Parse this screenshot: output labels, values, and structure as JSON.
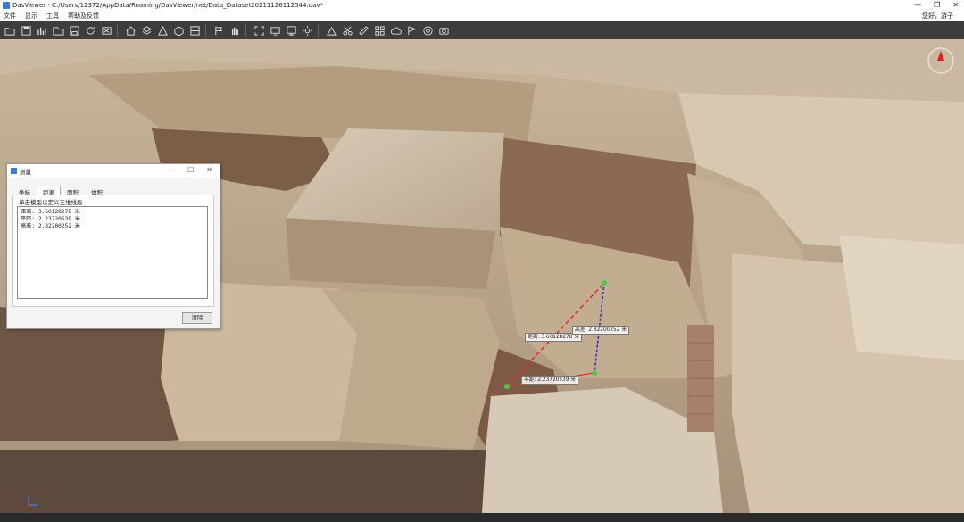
{
  "window": {
    "title": "DasViewer - C:/Users/12372/AppData/Roaming/DasViewer/net/Data_Dataset20211126112544.dav*",
    "controls": [
      "—",
      "❐",
      "✕"
    ]
  },
  "menu": {
    "items": [
      "文件",
      "显示",
      "工具",
      "帮助及反馈"
    ],
    "greeting": "您好，游子"
  },
  "toolbar": {
    "icons": [
      "folder-open-icon",
      "save-file-icon",
      "chart-icon",
      "folder-icon",
      "save-icon",
      "refresh-icon",
      "export-icon",
      "home-icon",
      "layers-icon",
      "cone-icon",
      "polygon-icon",
      "grid-icon",
      "flag-icon",
      "hand-icon",
      "fullscreen-icon",
      "screen-icon",
      "monitor-icon",
      "sun-icon",
      "measure-icon",
      "scissors-icon",
      "ruler-icon",
      "tile-icon",
      "cloud-icon",
      "flag2-icon",
      "target-icon",
      "camera-icon"
    ]
  },
  "dialog": {
    "title": "测量",
    "tabs": [
      "坐标",
      "距离",
      "面积",
      "体积"
    ],
    "active_tab": "距离",
    "hint": "单击模型以定义三维线段",
    "results": [
      "距离: 3.60128278 米",
      "平距: 2.23720539 米",
      "高差: 2.82200252 米"
    ],
    "clear_label": "清除"
  },
  "scene_labels": {
    "distance": "距离: 3.60128278 米",
    "height": "高差: 2.82200252 米",
    "horizontal": "平距: 2.23720539 米"
  },
  "colors": {
    "distance_line": "#e8302a",
    "height_line": "#2a36c8",
    "horizontal_line": "#e8302a",
    "point": "#4ac84a"
  }
}
